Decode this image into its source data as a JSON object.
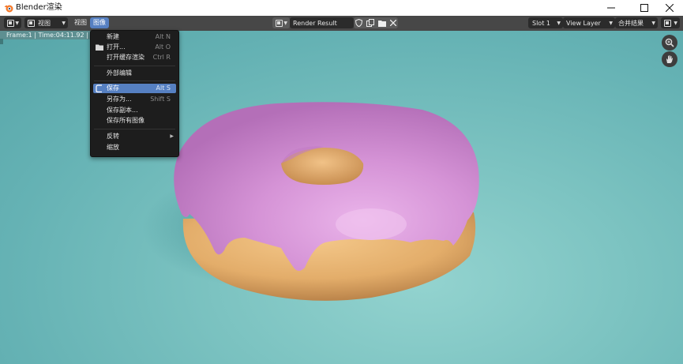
{
  "window": {
    "title": "Blender渲染",
    "controls": [
      "minimize-icon",
      "maximize-icon",
      "close-icon"
    ]
  },
  "header": {
    "editor_type_icon": "image-editor-icon",
    "view_mode": "视图",
    "menus": [
      "视图",
      "图像"
    ],
    "image_name": "Render Result",
    "slot": "Slot 1",
    "view_layer": "View Layer",
    "pass": "合并结果"
  },
  "viewport": {
    "frame_info": "Frame:1 | Time:04:11.92 | Mem"
  },
  "image_menu": {
    "items": [
      {
        "label": "新建",
        "shortcut": "Alt N"
      },
      {
        "label": "打开...",
        "shortcut": "Alt O"
      },
      {
        "label": "打开缓存渲染",
        "shortcut": "Ctrl R"
      },
      {
        "label": "外部编辑",
        "shortcut": ""
      },
      {
        "label": "保存",
        "shortcut": "Alt S"
      },
      {
        "label": "另存为...",
        "shortcut": "Shift S"
      },
      {
        "label": "保存副本...",
        "shortcut": ""
      },
      {
        "label": "保存所有图像",
        "shortcut": ""
      },
      {
        "label": "反转",
        "shortcut": ""
      },
      {
        "label": "缩放",
        "shortcut": ""
      }
    ]
  },
  "colors": {
    "accent": "#5680c2",
    "header_bg": "#474747",
    "menu_bg": "#1d1d1d",
    "icing": "#d693d8",
    "dough": "#e8b56f",
    "background": "#7cc3c1"
  }
}
